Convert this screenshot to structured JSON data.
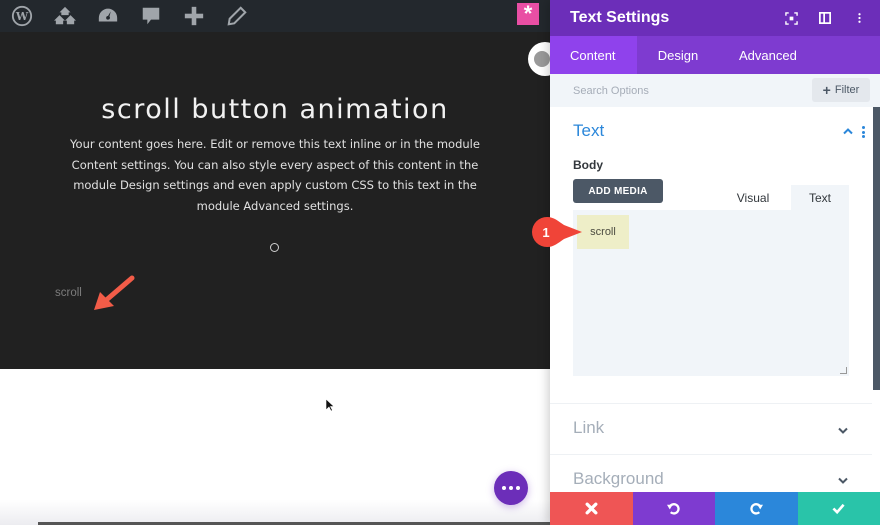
{
  "admin_bar": {
    "items": [
      {
        "icon": "wordpress-logo-icon"
      },
      {
        "icon": "my-sites-icon"
      },
      {
        "icon": "dashboard-icon"
      },
      {
        "icon": "comments-icon"
      },
      {
        "icon": "add-new-icon"
      },
      {
        "icon": "edit-icon"
      }
    ]
  },
  "builder": {
    "asterisk_label": "*"
  },
  "hero": {
    "title": "scroll button animation",
    "body": "Your content goes here. Edit or remove this text inline or in the module Content settings. You can also style every aspect of this content in the module Design settings and even apply custom CSS to this text in the module Advanced settings.",
    "scroll_link": "scroll"
  },
  "panel": {
    "title": "Text Settings",
    "header_icons": [
      "fullscreen-icon",
      "split-view-icon",
      "more-options-icon"
    ],
    "tabs": [
      {
        "label": "Content",
        "active": true
      },
      {
        "label": "Design",
        "active": false
      },
      {
        "label": "Advanced",
        "active": false
      }
    ],
    "search": {
      "placeholder": "Search Options",
      "value": ""
    },
    "filter_label": "Filter",
    "text_section": {
      "title": "Text",
      "body_label": "Body",
      "add_media_label": "ADD MEDIA",
      "editor_tabs": [
        "Visual",
        "Text"
      ],
      "editor_active_tab": "Text",
      "editor_value": "scroll",
      "annotation_number": "1"
    },
    "collapsed_sections": [
      {
        "title": "Link"
      },
      {
        "title": "Background"
      }
    ],
    "footer": {
      "discard": "discard-icon",
      "undo": "undo-icon",
      "redo": "redo-icon",
      "save": "save-check-icon"
    }
  },
  "colors": {
    "accent_purple": "#6c2eb9",
    "tab_purple": "#7e3bd0",
    "active_tab": "#8f42ec",
    "link_blue": "#2b87da",
    "discard_red": "#ef5555",
    "save_green": "#29c4a9",
    "hero_bg": "#212121",
    "annotation_red": "#f04438"
  }
}
